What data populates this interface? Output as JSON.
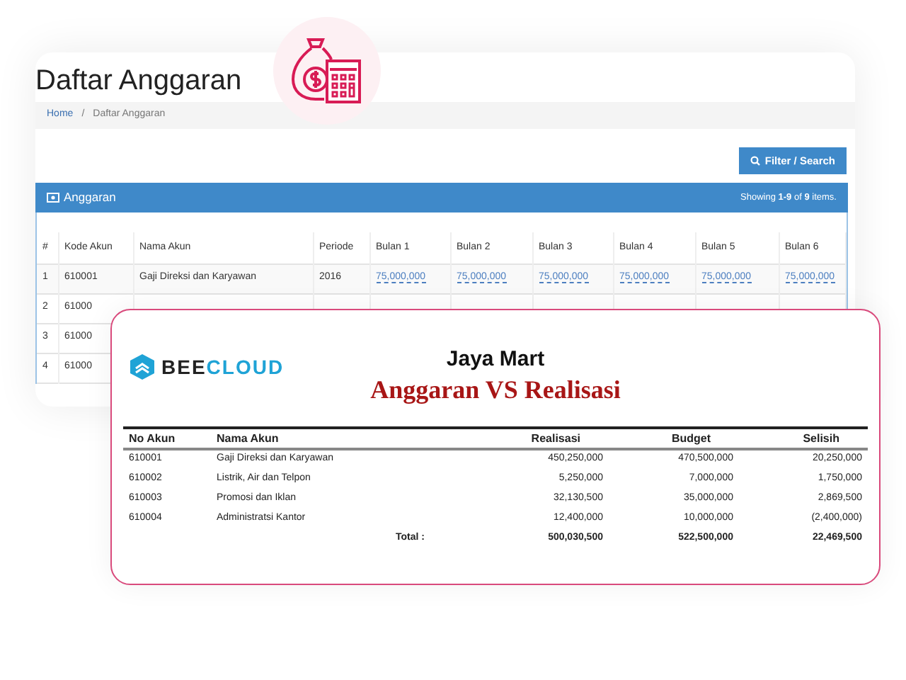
{
  "back_window": {
    "title": "Daftar Anggaran",
    "breadcrumb": [
      {
        "label": "Home",
        "link": true
      },
      {
        "label": "/",
        "link": false
      },
      {
        "label": "Daftar Anggaran",
        "link": false
      }
    ],
    "filter_button": "Filter / Search",
    "panel": {
      "title": "Anggaran",
      "summary": "Showing **1-9** of **9** items."
    },
    "columns": [
      "#",
      "Kode Akun",
      "Nama Akun",
      "Periode",
      "Bulan 1",
      "Bulan 2",
      "Bulan 3",
      "Bulan 4",
      "Bulan 5",
      "Bulan 6"
    ],
    "rows": [
      {
        "cells": [
          "1",
          "610001",
          "Gaji Direksi dan Karyawan",
          "2016",
          "75,000,000",
          "75,000,000",
          "75,000,000",
          "75,000,000",
          "75,000,000",
          "75,000,000"
        ]
      },
      {
        "cells": [
          "2",
          "61000"
        ]
      },
      {
        "cells": [
          "3",
          "61000"
        ]
      },
      {
        "cells": [
          "4",
          "61000"
        ]
      }
    ]
  },
  "report": {
    "logo": {
      "left": "BEE",
      "right": "CLOUD"
    },
    "company": "Jaya Mart",
    "title": "Anggaran VS Realisasi",
    "columns": [
      "No Akun",
      "Nama Akun",
      "Realisasi",
      "Budget",
      "Selisih"
    ],
    "rows": [
      {
        "cells": [
          "610001",
          "Gaji Direksi dan Karyawan",
          "450,250,000",
          "470,500,000",
          "20,250,000"
        ]
      },
      {
        "cells": [
          "610002",
          "Listrik, Air dan Telpon",
          "5,250,000",
          "7,000,000",
          "1,750,000"
        ]
      },
      {
        "cells": [
          "610003",
          "Promosi dan Iklan",
          "32,130,500",
          "35,000,000",
          "2,869,500"
        ]
      },
      {
        "cells": [
          "610004",
          "Administratsi Kantor",
          "12,400,000",
          "10,000,000",
          "(2,400,000)"
        ]
      }
    ],
    "total": {
      "label": "Total :",
      "values": [
        "500,030,500",
        "522,500,000",
        "22,469,500"
      ]
    }
  }
}
